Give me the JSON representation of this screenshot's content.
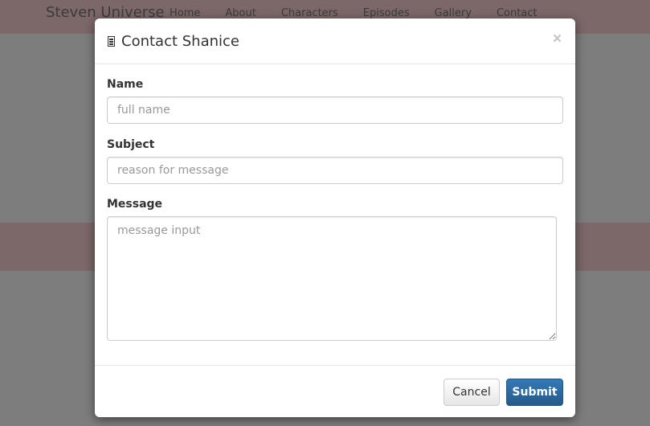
{
  "background": {
    "brand": "Steven Universe",
    "nav": [
      "Home",
      "About",
      "Characters",
      "Episodes",
      "Gallery",
      "Contact"
    ]
  },
  "modal": {
    "title": "Contact Shanice",
    "title_icon": "barcode-icon",
    "close_label": "×",
    "fields": {
      "name": {
        "label": "Name",
        "placeholder": "full name"
      },
      "subject": {
        "label": "Subject",
        "placeholder": "reason for message"
      },
      "message": {
        "label": "Message",
        "placeholder": "message input"
      }
    },
    "buttons": {
      "cancel": "Cancel",
      "submit": "Submit"
    }
  },
  "colors": {
    "navbar_bg": "#f9cfd3",
    "primary": "#337ab7"
  }
}
